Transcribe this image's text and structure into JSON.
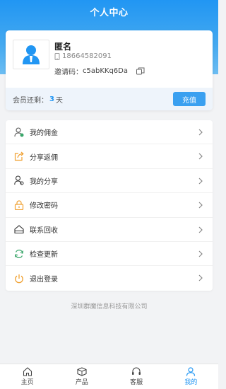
{
  "header": {
    "title": "个人中心"
  },
  "profile": {
    "name": "匿名",
    "phone": "18664582091",
    "invite_label": "邀请码：",
    "invite_code": "c5abKKq6Da"
  },
  "membership": {
    "prefix": "会员还剩：",
    "days": "3",
    "suffix": "天",
    "recharge_label": "充值"
  },
  "menu": [
    {
      "label": "我的佣金",
      "icon": "commission-user-icon",
      "color": "#3aa66a"
    },
    {
      "label": "分享返佣",
      "icon": "share-icon",
      "color": "#f0a030"
    },
    {
      "label": "我的分享",
      "icon": "users-share-icon",
      "color": "#333333"
    },
    {
      "label": "修改密码",
      "icon": "lock-icon",
      "color": "#f0a030"
    },
    {
      "label": "联系回收",
      "icon": "recycle-contact-icon",
      "color": "#333333"
    },
    {
      "label": "检查更新",
      "icon": "refresh-icon",
      "color": "#3aa66a"
    },
    {
      "label": "退出登录",
      "icon": "power-icon",
      "color": "#f0a030"
    }
  ],
  "footer": {
    "company": "深圳群魔信息科技有限公司"
  },
  "tabbar": [
    {
      "label": "主页",
      "icon": "home-icon"
    },
    {
      "label": "产品",
      "icon": "box-icon"
    },
    {
      "label": "客服",
      "icon": "headset-icon"
    },
    {
      "label": "我的",
      "icon": "person-icon",
      "active": true
    }
  ],
  "colors": {
    "primary": "#2196f3",
    "background": "#f2f3f5"
  }
}
